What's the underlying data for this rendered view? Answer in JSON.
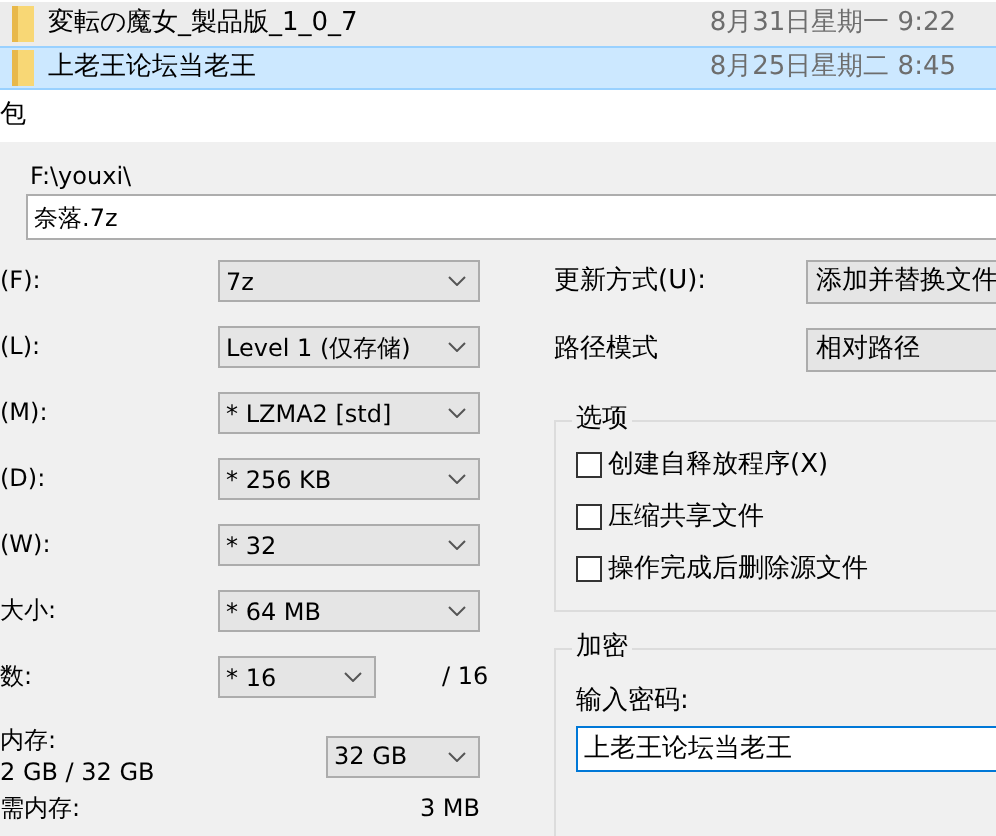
{
  "file_list": [
    {
      "name": "変転の魔女_製品版_1_0_7",
      "date": "8月31日星期一 9:22",
      "selected": false
    },
    {
      "name": "上老王论坛当老王",
      "date": "8月25日星期二 8:45",
      "selected": true
    }
  ],
  "dialog": {
    "title": "包",
    "path": "F:\\youxi\\",
    "archive_name": "奈落.7z"
  },
  "left_rows": [
    {
      "kind": "combo",
      "label": "(F):",
      "value": "7z"
    },
    {
      "kind": "combo",
      "label": "(L):",
      "value": "Level 1 (仅存储)"
    },
    {
      "kind": "combo",
      "label": "(M):",
      "value": "* LZMA2 [std]"
    },
    {
      "kind": "combo",
      "label": "(D):",
      "value": "* 256 KB"
    },
    {
      "kind": "combo",
      "label": "(W):",
      "value": "* 32"
    },
    {
      "kind": "combo",
      "label": "大小:",
      "value": "* 64 MB"
    },
    {
      "kind": "threads",
      "label": "数:",
      "value": "* 16",
      "suffix": "/ 16"
    },
    {
      "kind": "memory",
      "label": "内存:",
      "sublabel": "2 GB / 32 GB",
      "value": "32 GB"
    },
    {
      "kind": "info",
      "label": "需内存:",
      "value": "3 MB"
    }
  ],
  "update_mode": {
    "label": "更新方式(U):",
    "value": "添加并替换文件"
  },
  "path_mode": {
    "label": "路径模式",
    "value": "相对路径"
  },
  "options": {
    "title": "选项",
    "items": [
      {
        "label": "创建自释放程序(X)",
        "checked": false
      },
      {
        "label": "压缩共享文件",
        "checked": false
      },
      {
        "label": "操作完成后删除源文件",
        "checked": false
      }
    ]
  },
  "encryption": {
    "title": "加密",
    "password_label": "输入密码:",
    "password": "上老王论坛当老王"
  }
}
